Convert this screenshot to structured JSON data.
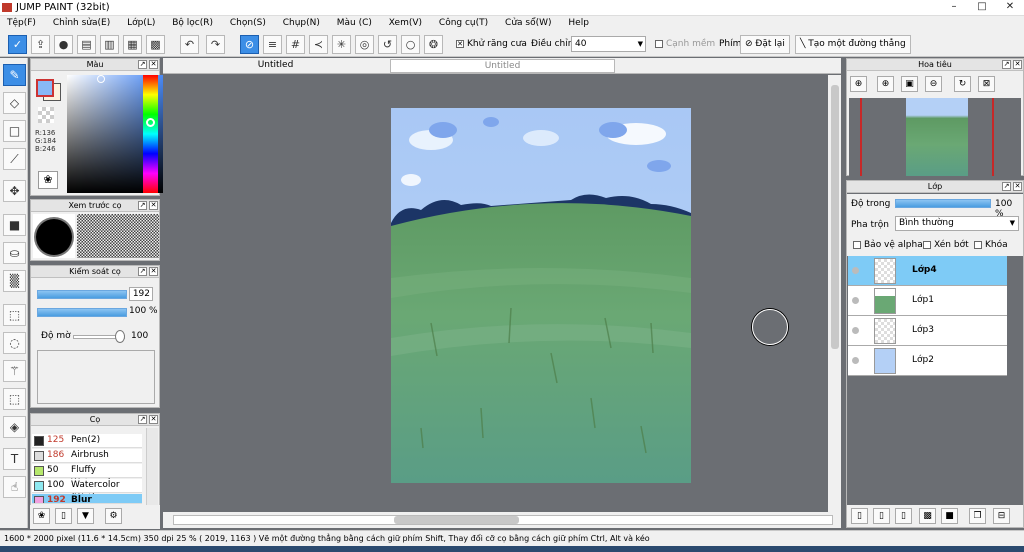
{
  "window": {
    "title": "JUMP PAINT (32bit)"
  },
  "menu": [
    "Tệp(F)",
    "Chỉnh sửa(E)",
    "Lớp(L)",
    "Bộ lọc(R)",
    "Chọn(S)",
    "Chụp(N)",
    "Màu (C)",
    "Xem(V)",
    "Công cụ(T)",
    "Cửa sổ(W)",
    "Help"
  ],
  "toolbar": {
    "antialias_label": "Khử răng cưa",
    "adjust_label": "Điều chỉnh",
    "adjust_value": "40",
    "edge_label": "Cạnh mềm",
    "key_label": "Phím",
    "reset_label": "Đặt lại",
    "straight_line_label": "Tạo một đường thẳng"
  },
  "color_panel": {
    "title": "Màu",
    "r": "R:136",
    "g": "G:184",
    "b": "B:246",
    "fg_color": "#88b8f6",
    "bg_color": "#fdf3df"
  },
  "brush_preview": {
    "title": "Xem trước cọ"
  },
  "brush_control": {
    "title": "Kiểm soát cọ",
    "size": "192",
    "density": "100 %",
    "opacity_label": "Độ mờ",
    "opacity_value": "100"
  },
  "brushes": {
    "title": "Cọ",
    "items": [
      {
        "num": "125",
        "name": "Pen(2)",
        "color": "#222222"
      },
      {
        "num": "186",
        "name": "Airbrush",
        "color": "#dddddd"
      },
      {
        "num": "50",
        "name": "Fluffy Watercolor",
        "color": "#b6e86c"
      },
      {
        "num": "100",
        "name": "Watercolor (Wet)",
        "color": "#8ee8f0"
      },
      {
        "num": "192",
        "name": "Blur",
        "color": "#f0a0e0"
      }
    ]
  },
  "tabs": [
    "Untitled",
    "Untitled"
  ],
  "navigator": {
    "title": "Hoa tiêu"
  },
  "layers": {
    "title": "Lớp",
    "opacity_label": "Độ trong",
    "opacity_value": "100 %",
    "blend_label": "Pha trộn",
    "blend_value": "Bình thường",
    "protect_alpha": "Bảo vệ alpha",
    "clip": "Xén bớt",
    "lock": "Khóa",
    "items": [
      "Lớp4",
      "Lớp1",
      "Lớp3",
      "Lớp2"
    ]
  },
  "status": "1600 * 2000 pixel   (11.6 * 14.5cm)   350 dpi   25 %   ( 2019, 1163 )   Vẽ một đường thẳng bằng cách giữ phím Shift, Thay đổi cỡ cọ bằng cách giữ phím Ctrl, Alt và kéo"
}
